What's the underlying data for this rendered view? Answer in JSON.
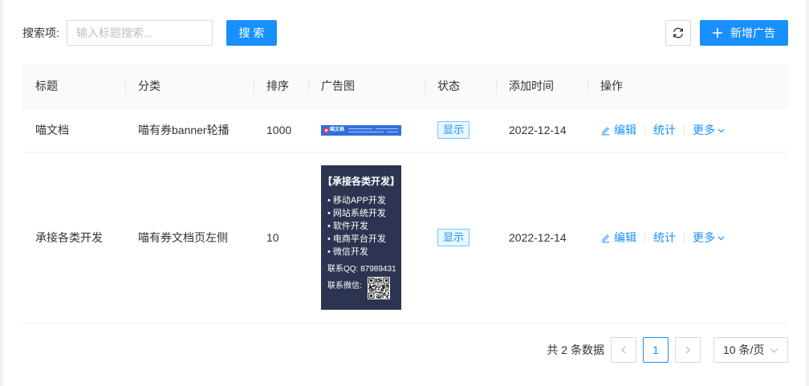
{
  "search": {
    "label": "搜索项:",
    "value": "",
    "placeholder": "输入标题搜索...",
    "button_label": "搜 索"
  },
  "toolbar": {
    "refresh_icon": "refresh-icon",
    "add_icon": "plus-icon",
    "add_button_label": "新增广告"
  },
  "table": {
    "columns": [
      "标题",
      "分类",
      "排序",
      "广告图",
      "状态",
      "添加时间",
      "操作"
    ],
    "rows": [
      {
        "title": "喵文档",
        "category": "喵有券banner轮播",
        "sort": "1000",
        "image": {
          "logo_text": "喵文档"
        },
        "status": "显示",
        "added_at": "2022-12-14",
        "actions": {
          "edit": "编辑",
          "stats": "统计",
          "more": "更多"
        }
      },
      {
        "title": "承接各类开发",
        "category": "喵有券文档页左侧",
        "sort": "10",
        "image": {
          "heading": "【承接各类开发】",
          "items": [
            "• 移动APP开发",
            "• 网站系统开发",
            "• 软件开发",
            "• 电商平台开发",
            "• 微信开发"
          ],
          "qq_line": "联系QQ: 87989431",
          "wechat_label": "联系微信:"
        },
        "status": "显示",
        "added_at": "2022-12-14",
        "actions": {
          "edit": "编辑",
          "stats": "统计",
          "more": "更多"
        }
      }
    ],
    "action_icons": {
      "edit": "edit-icon",
      "more": "chevron-down-icon"
    }
  },
  "pagination": {
    "total_text": "共 2 条数据",
    "current_page": "1",
    "page_size_label": "10 条/页",
    "icons": {
      "prev": "chevron-left-icon",
      "next": "chevron-right-icon",
      "page_size": "chevron-down-icon"
    }
  },
  "colors": {
    "primary": "#1890ff",
    "banner_bg": "#2f6fdc",
    "poster_bg": "#2d3451"
  }
}
